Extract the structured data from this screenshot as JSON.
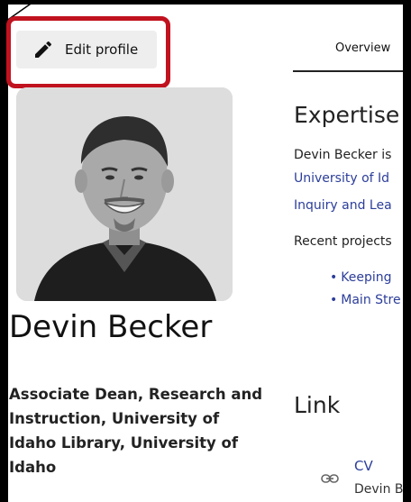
{
  "toolbar": {
    "edit_label": "Edit profile"
  },
  "profile": {
    "name": "Devin Becker",
    "affiliation": "Associate Dean, Research and Instruction, University of Idaho Library, University of Idaho",
    "photo_alt": "Portrait of Devin Becker"
  },
  "tabs": [
    {
      "label": "Overview",
      "active": true
    }
  ],
  "expertise": {
    "heading": "Expertise",
    "line1": "Devin Becker is",
    "line2": "University of Id",
    "line3": "Inquiry and Lea",
    "line4": "Recent projects",
    "projects": [
      "Keeping",
      "Main Stre"
    ]
  },
  "links": {
    "heading": "Link",
    "cv_label": "CV",
    "cv_sub": "Devin B"
  },
  "colors": {
    "highlight": "#c1121f",
    "link": "#2c3e9a",
    "button_bg": "#eeeeee"
  },
  "icons": {
    "edit": "pencil-icon",
    "link": "link-icon"
  }
}
